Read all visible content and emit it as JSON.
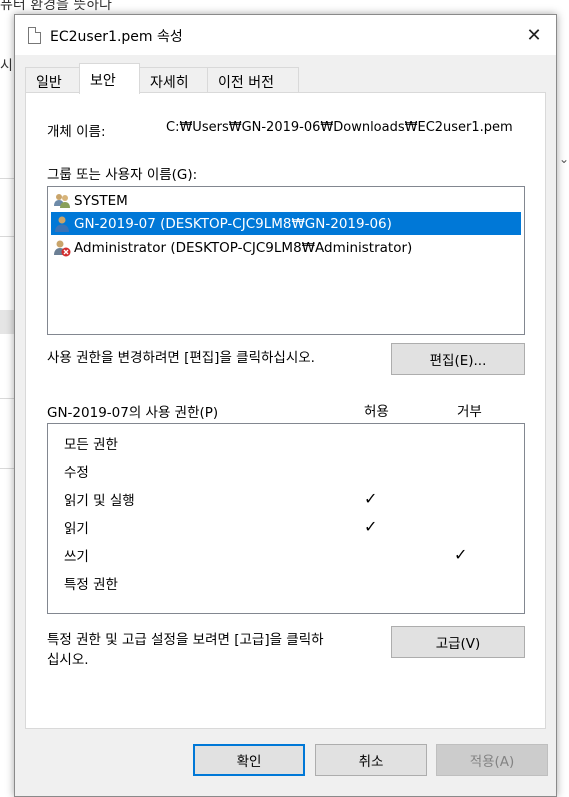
{
  "background": {
    "top_text": "퓨터 환경을 뜻하다",
    "side_text": "시"
  },
  "dialog": {
    "title": "EC2user1.pem 속성",
    "close_glyph": "✕",
    "tabs": [
      {
        "label": "일반",
        "active": false
      },
      {
        "label": "보안",
        "active": true
      },
      {
        "label": "자세히",
        "active": false
      },
      {
        "label": "이전 버전",
        "active": false
      }
    ],
    "object_name_label": "개체 이름:",
    "object_name_value": "C:₩Users₩GN-2019-06₩Downloads₩EC2user1.pem",
    "group_label": "그룹 또는 사용자 이름(G):",
    "users": [
      {
        "name": "SYSTEM",
        "icon": "users-group-icon",
        "selected": false
      },
      {
        "name": "GN-2019-07 (DESKTOP-CJC9LM8₩GN-2019-06)",
        "icon": "user-icon",
        "selected": true
      },
      {
        "name": "Administrator (DESKTOP-CJC9LM8₩Administrator)",
        "icon": "user-denied-icon",
        "selected": false
      }
    ],
    "edit_hint": "사용 권한을 변경하려면 [편집]을 클릭하십시오.",
    "edit_button": "편집(E)...",
    "perm_label": "GN-2019-07의 사용 권한(P)",
    "allow_header": "허용",
    "deny_header": "거부",
    "permissions": [
      {
        "name": "모든 권한",
        "allow": false,
        "deny": false
      },
      {
        "name": "수정",
        "allow": false,
        "deny": false
      },
      {
        "name": "읽기 및 실행",
        "allow": true,
        "deny": false
      },
      {
        "name": "읽기",
        "allow": true,
        "deny": false
      },
      {
        "name": "쓰기",
        "allow": false,
        "deny": true
      },
      {
        "name": "특정 권한",
        "allow": false,
        "deny": false
      }
    ],
    "advanced_hint_line1": "특정 권한 및 고급 설정을 보려면 [고급]을 클릭하",
    "advanced_hint_line2": "십시오.",
    "advanced_button": "고급(V)",
    "ok_button": "확인",
    "cancel_button": "취소",
    "apply_button": "적용(A)",
    "check_glyph": "✓"
  }
}
